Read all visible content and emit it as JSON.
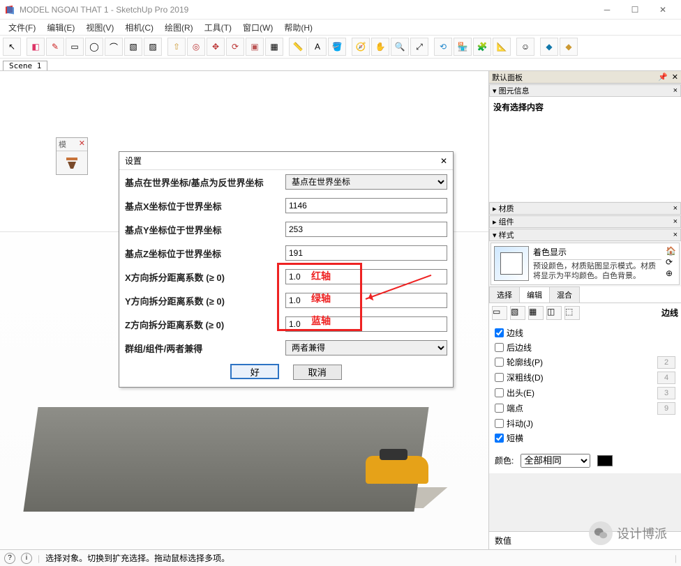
{
  "window": {
    "title": "MODEL NGOAI THAT 1 - SketchUp Pro 2019"
  },
  "menu": {
    "items": [
      "文件(F)",
      "编辑(E)",
      "视图(V)",
      "相机(C)",
      "绘图(R)",
      "工具(T)",
      "窗口(W)",
      "帮助(H)"
    ]
  },
  "scene": {
    "tab": "Scene 1"
  },
  "mini_panel": {
    "label": "模",
    "close": "✕"
  },
  "dialog": {
    "title": "设置",
    "rows": {
      "coord_mode_label": "基点在世界坐标/基点为反世界坐标",
      "coord_mode_value": "基点在世界坐标",
      "x_label": "基点X坐标位于世界坐标",
      "x_value": "1146",
      "y_label": "基点Y坐标位于世界坐标",
      "y_value": "253",
      "z_label": "基点Z坐标位于世界坐标",
      "z_value": "191",
      "fx_label": "X方向拆分距离系数 (≥ 0)",
      "fx_value": "1.0",
      "fy_label": "Y方向拆分距离系数 (≥ 0)",
      "fy_value": "1.0",
      "fz_label": "Z方向拆分距离系数 (≥ 0)",
      "fz_value": "1.0",
      "target_label": "群组/组件/两者兼得",
      "target_value": "两者兼得"
    },
    "ok": "好",
    "cancel": "取消"
  },
  "annotations": {
    "red_x": "红轴",
    "red_y": "绿轴",
    "red_z": "蓝轴"
  },
  "side": {
    "default_panel": "默认面板",
    "entity_info": "图元信息",
    "no_selection": "没有选择内容",
    "materials": "材质",
    "components": "组件",
    "styles": "样式",
    "style_name": "着色显示",
    "style_desc": "预设颜色，材质贴图显示模式。材质将显示为平均颜色。白色背景。",
    "tabs": {
      "select": "选择",
      "edit": "编辑",
      "mix": "混合"
    },
    "edges_label": "边线",
    "edge_opts": {
      "edges": "边线",
      "back": "后边线",
      "profiles": "轮廓线(P)",
      "depth": "深粗线(D)",
      "ext": "出头(E)",
      "endpoints": "端点",
      "jitter": "抖动(J)",
      "short": "短横"
    },
    "edge_nums": {
      "profiles": "2",
      "depth": "4",
      "ext": "3",
      "endpoints": "9"
    },
    "color_label": "颜色:",
    "color_mode": "全部相同",
    "value_label": "数值"
  },
  "status": {
    "hint": "选择对象。切换到扩充选择。拖动鼠标选择多项。"
  },
  "overlay": {
    "brand": "设计博派"
  },
  "icons": {
    "select": "↖",
    "eraser": "◧",
    "pencil": "✎",
    "rect": "▭",
    "circle": "◯",
    "arc": "⌒",
    "pushpull": "⇧",
    "offset": "◎",
    "move": "✥",
    "rotate": "⟳",
    "scale": "◫",
    "tape": "📏",
    "text": "A",
    "paint": "🪣",
    "orbit": "🧭",
    "pan": "✋",
    "zoom": "🔍",
    "zoomext": "⤢",
    "prev": "⟲",
    "warehouse": "🏪",
    "ext": "🧩",
    "layout": "📐",
    "user": "☺",
    "help": "?",
    "close": "✕"
  }
}
